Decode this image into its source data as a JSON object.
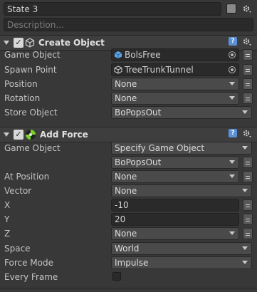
{
  "state": {
    "name": "State 3",
    "description_placeholder": "Description..."
  },
  "actions": [
    {
      "title": "Create Object",
      "rows": [
        {
          "label": "Game Object",
          "value": "BolsFree",
          "kind": "object",
          "icon": "cube-icon"
        },
        {
          "label": "Spawn Point",
          "value": "TreeTrunkTunnel",
          "kind": "object",
          "icon": "gameobject-icon"
        },
        {
          "label": "Position",
          "value": "None",
          "kind": "dropdown"
        },
        {
          "label": "Rotation",
          "value": "None",
          "kind": "dropdown"
        },
        {
          "label": "Store Object",
          "value": "BoPopsOut",
          "kind": "dropdown"
        }
      ]
    },
    {
      "title": "Add Force",
      "rows": [
        {
          "label": "Game Object",
          "value": "Specify Game Object",
          "kind": "dropdown"
        },
        {
          "label": "",
          "value": "BoPopsOut",
          "kind": "dropdown"
        },
        {
          "label": "At Position",
          "value": "None",
          "kind": "dropdown"
        },
        {
          "label": "Vector",
          "value": "None",
          "kind": "dropdown"
        },
        {
          "label": "X",
          "value": "-10",
          "kind": "text"
        },
        {
          "label": "Y",
          "value": "20",
          "kind": "text"
        },
        {
          "label": "Z",
          "value": "None",
          "kind": "dropdown"
        },
        {
          "label": "Space",
          "value": "World",
          "kind": "dropdown"
        },
        {
          "label": "Force Mode",
          "value": "Impulse",
          "kind": "dropdown"
        },
        {
          "label": "Every Frame",
          "value": "",
          "kind": "checkbox"
        }
      ]
    }
  ],
  "colors": {
    "background": "#383838",
    "field": "#2a2a2a",
    "dropdown": "#4a4a4a",
    "help": "#5b8fd6"
  }
}
